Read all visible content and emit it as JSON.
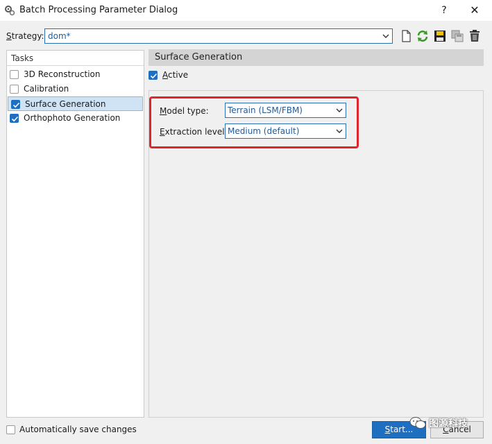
{
  "window": {
    "title": "Batch Processing Parameter Dialog",
    "help_label": "?",
    "close_label": "✕"
  },
  "strategy": {
    "label_prefix": "",
    "label_underlined": "S",
    "label_rest": "trategy:",
    "value": "dom*"
  },
  "toolbar": {
    "icons": [
      "new-document-icon",
      "reload-icon",
      "save-icon",
      "save-as-icon",
      "delete-icon"
    ]
  },
  "tasks": {
    "header": "Tasks",
    "items": [
      {
        "label": "3D Reconstruction",
        "checked": false,
        "selected": false
      },
      {
        "label": "Calibration",
        "checked": false,
        "selected": false
      },
      {
        "label": "Surface Generation",
        "checked": true,
        "selected": true
      },
      {
        "label": "Orthophoto Generation",
        "checked": true,
        "selected": false
      }
    ]
  },
  "section": {
    "title": "Surface Generation",
    "active_underlined": "A",
    "active_rest": "ctive",
    "active_checked": true
  },
  "params": {
    "model_type": {
      "label_underlined": "M",
      "label_rest": "odel type:",
      "value": "Terrain (LSM/FBM)"
    },
    "extraction_level": {
      "label_underlined": "E",
      "label_rest": "xtraction level:",
      "value": "Medium (default)"
    }
  },
  "autosave": {
    "label": "Automatically save changes",
    "checked": false
  },
  "buttons": {
    "start_underlined": "S",
    "start_rest": "tart...",
    "cancel_underlined": "C",
    "cancel_rest": "ancel"
  },
  "watermark": {
    "text": "图源科技"
  },
  "colors": {
    "accent": "#1f6fc1",
    "highlight": "#e0262b",
    "selection": "#cfe3f5"
  }
}
